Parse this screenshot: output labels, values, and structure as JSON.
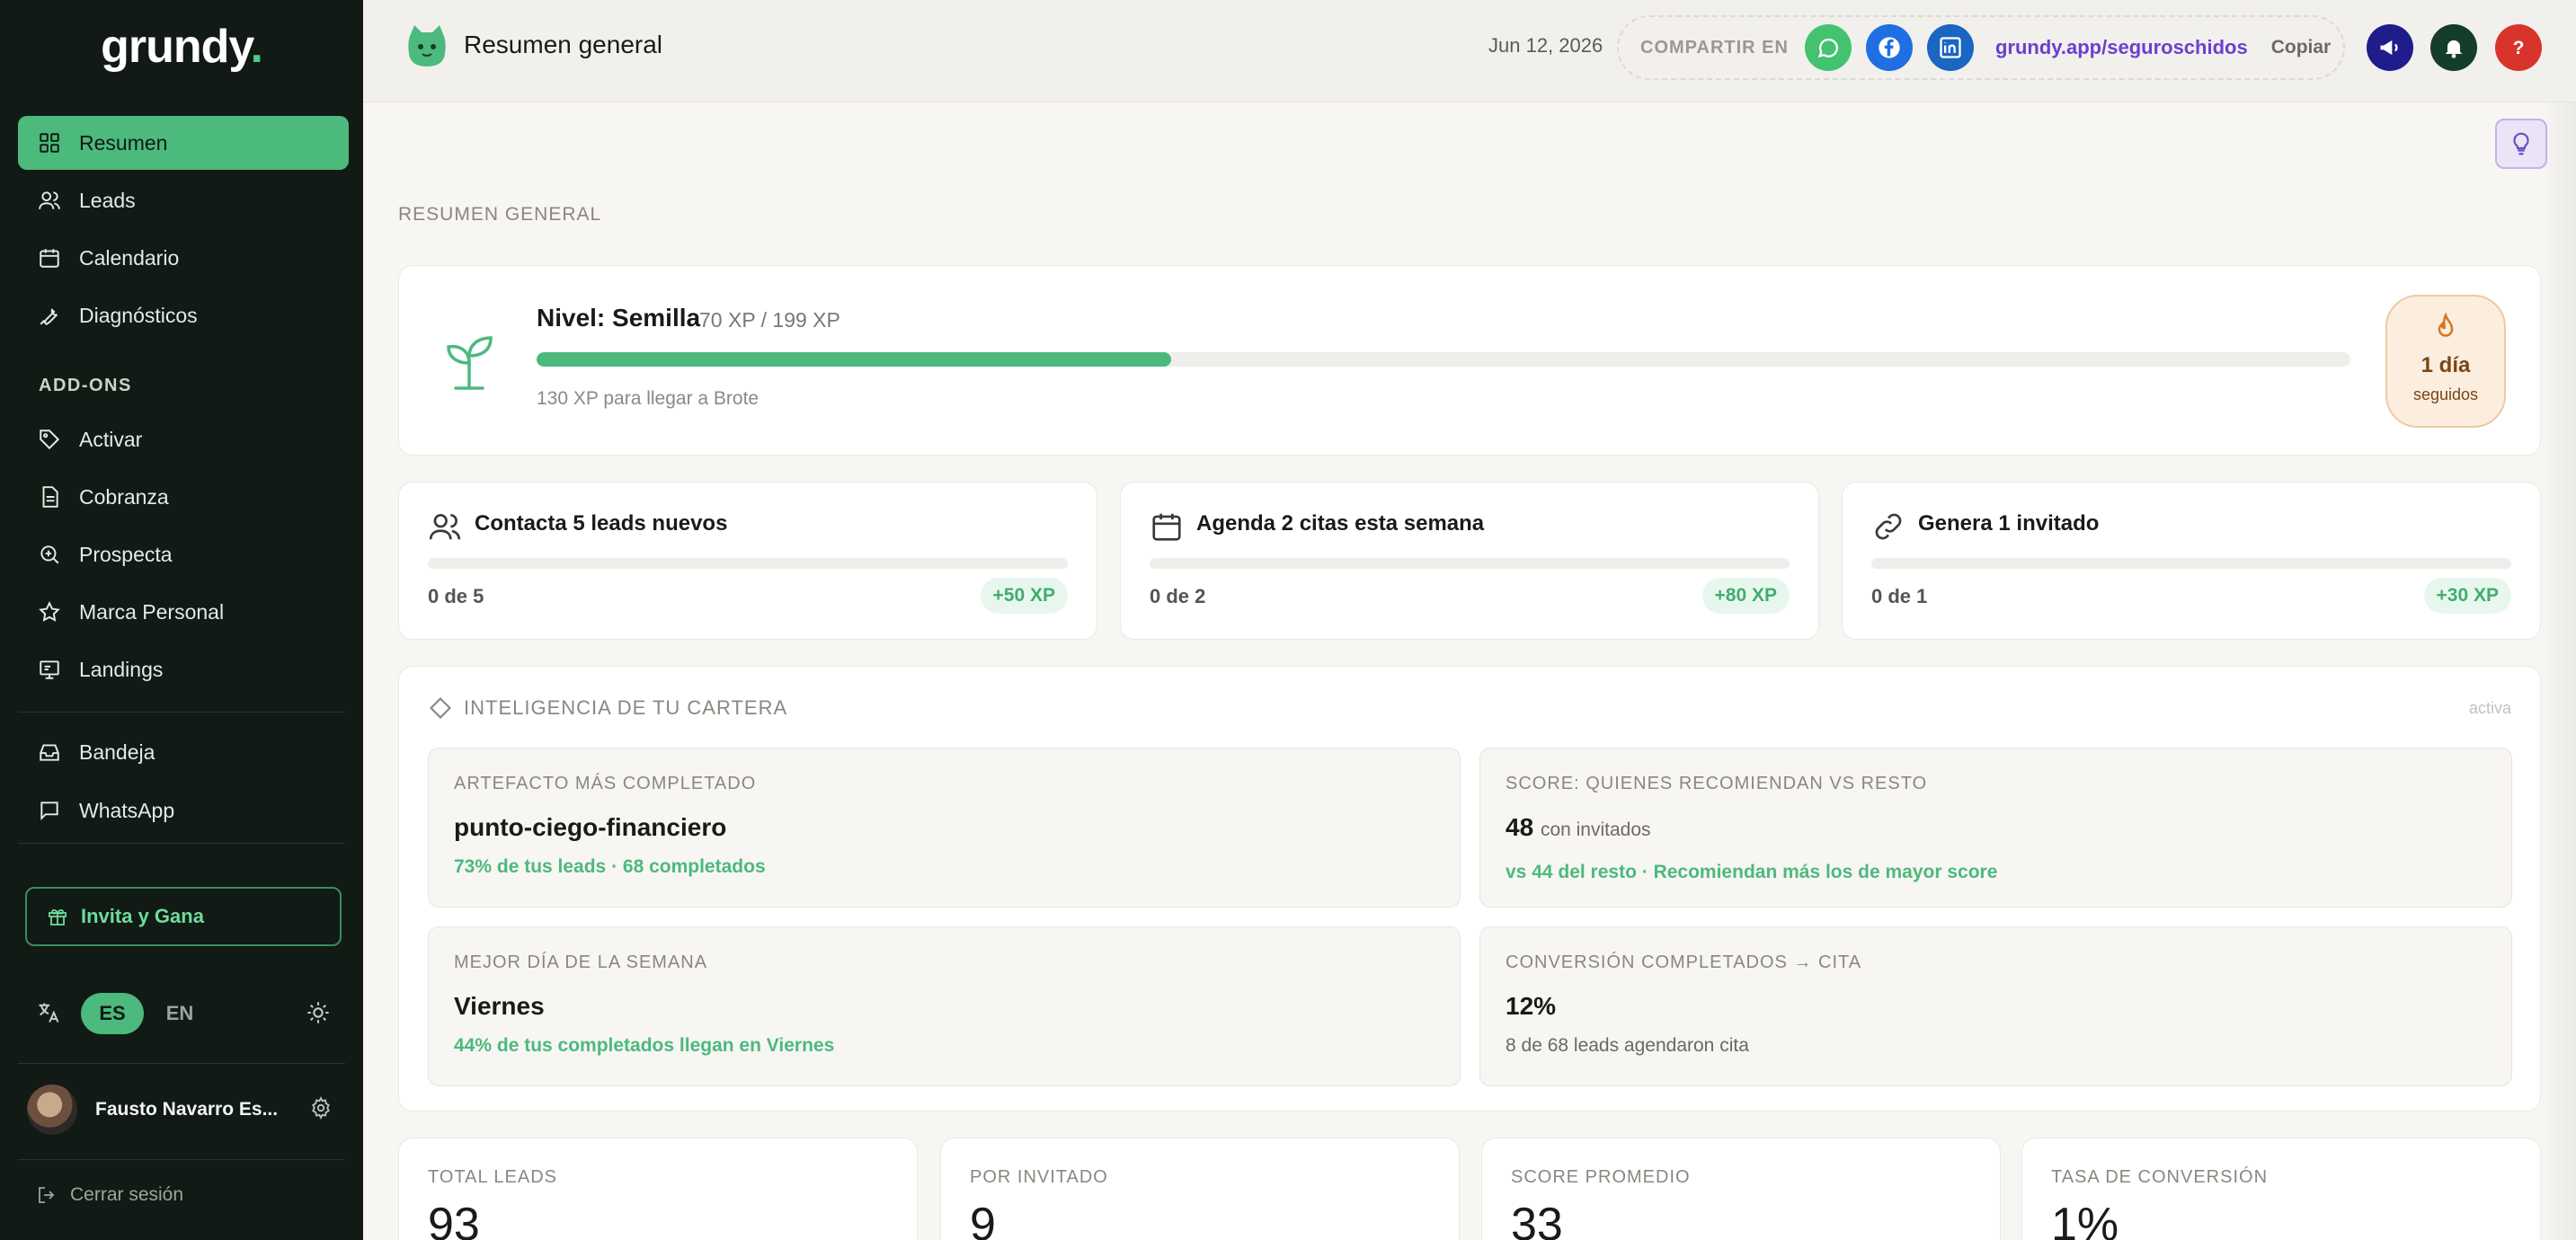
{
  "app": {
    "logo": "grundy",
    "logo_dot": "."
  },
  "sidebar": {
    "items": [
      {
        "label": "Resumen",
        "icon": "grid-icon",
        "active": true
      },
      {
        "label": "Leads",
        "icon": "users-icon"
      },
      {
        "label": "Calendario",
        "icon": "calendar-icon"
      },
      {
        "label": "Diagnósticos",
        "icon": "wrench-icon"
      }
    ],
    "addons_label": "ADD-ONS",
    "addons": [
      {
        "label": "Activar",
        "icon": "tag-icon"
      },
      {
        "label": "Cobranza",
        "icon": "document-icon"
      },
      {
        "label": "Prospecta",
        "icon": "search-plus-icon"
      },
      {
        "label": "Marca Personal",
        "icon": "star-icon"
      },
      {
        "label": "Landings",
        "icon": "monitor-icon"
      }
    ],
    "inbox": [
      {
        "label": "Bandeja",
        "icon": "inbox-icon"
      },
      {
        "label": "WhatsApp",
        "icon": "chat-icon"
      }
    ],
    "invite_label": "Invita y Gana",
    "lang_es": "ES",
    "lang_en": "EN",
    "user_name": "Fausto Navarro Es...",
    "logout_label": "Cerrar sesión"
  },
  "header": {
    "title": "Resumen general",
    "date": "Jun 12, 2026",
    "share_label": "COMPARTIR EN",
    "share_link": "grundy.app/seguroschidos",
    "copy_label": "Copiar"
  },
  "main": {
    "section_title": "RESUMEN GENERAL",
    "level": {
      "name": "Nivel: Semilla",
      "xp": "70 XP / 199 XP",
      "progress": 0.35,
      "hint": "130 XP para llegar a Brote",
      "streak_days": "1 día",
      "streak_label": "seguidos"
    },
    "tasks": [
      {
        "title": "Contacta 5 leads nuevos",
        "progress": "0 de 5",
        "reward": "+50 XP",
        "fill": 0
      },
      {
        "title": "Agenda 2 citas esta semana",
        "progress": "0 de 2",
        "reward": "+80 XP",
        "fill": 0
      },
      {
        "title": "Genera 1 invitado",
        "progress": "0 de 1",
        "reward": "+30 XP",
        "fill": 0
      }
    ],
    "intel": {
      "title": "INTELIGENCIA DE TU CARTERA",
      "status": "activa",
      "boxes": [
        {
          "label": "ARTEFACTO MÁS COMPLETADO",
          "value": "punto-ciego-financiero",
          "sub": "73% de tus leads · 68 completados"
        },
        {
          "label": "SCORE: QUIENES RECOMIENDAN VS RESTO",
          "value": "48",
          "value_suffix": "con invitados",
          "sub": "vs 44 del resto · Recomiendan más los de mayor score"
        },
        {
          "label": "MEJOR DÍA DE LA SEMANA",
          "value": "Viernes",
          "sub": "44% de tus completados llegan en Viernes"
        },
        {
          "label": "CONVERSIÓN COMPLETADOS → CITA",
          "value": "12%",
          "sub": "8 de 68 leads agendaron cita"
        }
      ]
    },
    "stats": [
      {
        "label": "TOTAL LEADS",
        "value": "93"
      },
      {
        "label": "POR INVITADO",
        "value": "9"
      },
      {
        "label": "SCORE PROMEDIO",
        "value": "33"
      },
      {
        "label": "TASA DE CONVERSIÓN",
        "value": "1%"
      }
    ]
  },
  "colors": {
    "accent": "#4cb97d",
    "sidebar_bg": "#111a15",
    "link": "#6b3fd1"
  }
}
